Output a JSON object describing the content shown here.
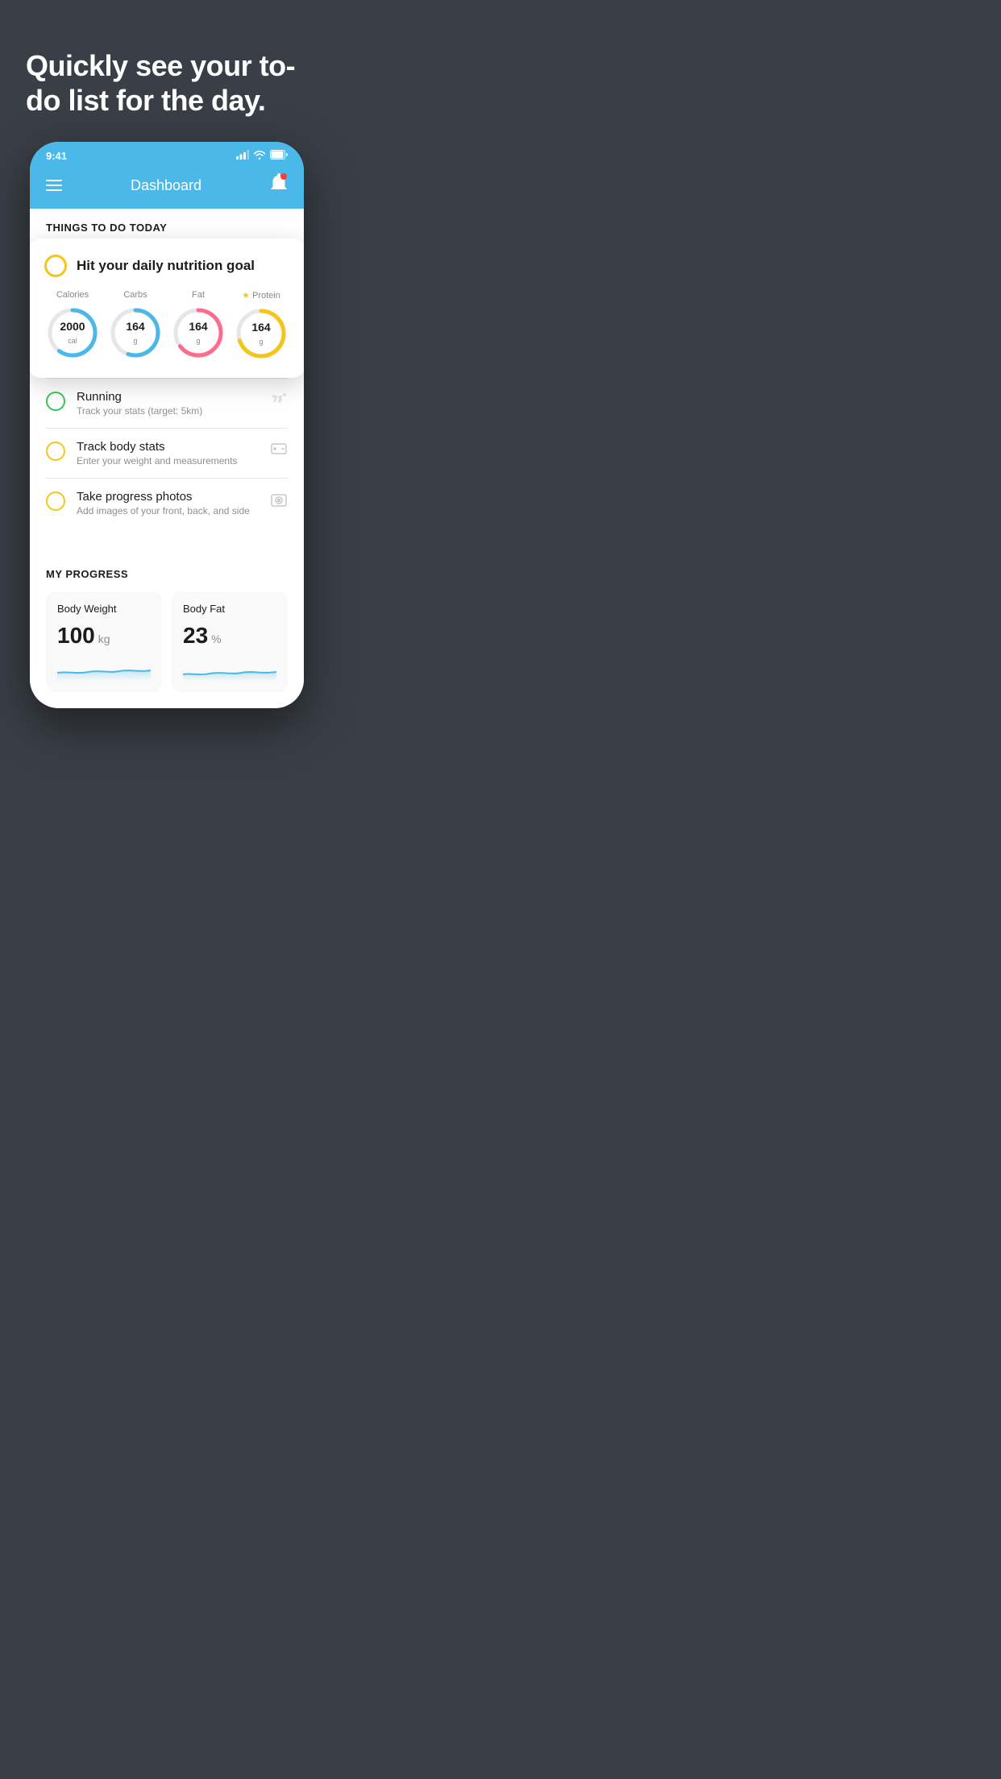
{
  "hero": {
    "title": "Quickly see your to-do list for the day."
  },
  "phone": {
    "statusBar": {
      "time": "9:41",
      "signal": "▌▌▌▌",
      "wifi": "wifi",
      "battery": "battery"
    },
    "navbar": {
      "title": "Dashboard",
      "menu": "menu",
      "bell": "bell"
    },
    "thingsToDoHeader": "THINGS TO DO TODAY",
    "floatingCard": {
      "title": "Hit your daily nutrition goal",
      "nutrients": [
        {
          "label": "Calories",
          "value": "2000",
          "unit": "cal",
          "color": "#4ab8e8",
          "percent": 60
        },
        {
          "label": "Carbs",
          "value": "164",
          "unit": "g",
          "color": "#4ab8e8",
          "percent": 55
        },
        {
          "label": "Fat",
          "value": "164",
          "unit": "g",
          "color": "#ff6b8a",
          "percent": 65
        },
        {
          "label": "Protein",
          "value": "164",
          "unit": "g",
          "color": "#f5c518",
          "percent": 70,
          "starred": true
        }
      ]
    },
    "todoItems": [
      {
        "title": "Running",
        "subtitle": "Track your stats (target: 5km)",
        "circleColor": "green",
        "icon": "👟"
      },
      {
        "title": "Track body stats",
        "subtitle": "Enter your weight and measurements",
        "circleColor": "yellow",
        "icon": "⚖️"
      },
      {
        "title": "Take progress photos",
        "subtitle": "Add images of your front, back, and side",
        "circleColor": "yellow",
        "icon": "👤"
      }
    ],
    "progressSection": {
      "header": "MY PROGRESS",
      "cards": [
        {
          "title": "Body Weight",
          "value": "100",
          "unit": "kg"
        },
        {
          "title": "Body Fat",
          "value": "23",
          "unit": "%"
        }
      ]
    }
  }
}
